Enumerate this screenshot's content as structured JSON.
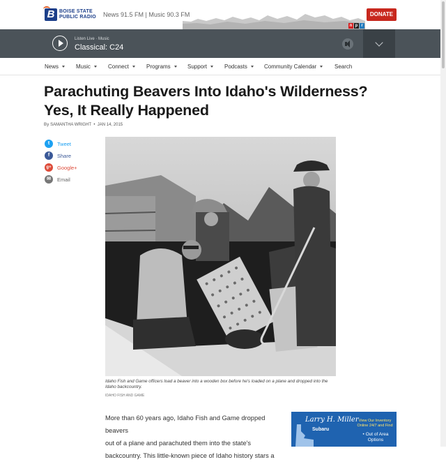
{
  "header": {
    "logo": {
      "line1": "BOISE STATE",
      "line2": "PUBLIC RADIO"
    },
    "stations": "News 91.5 FM | Music 90.3 FM",
    "donate_label": "DONATE",
    "npr_letters": [
      "n",
      "p",
      "r"
    ]
  },
  "player": {
    "listen_label": "Listen Live · Music",
    "now_playing": "Classical: C24"
  },
  "nav": {
    "items": [
      {
        "label": "News"
      },
      {
        "label": "Music"
      },
      {
        "label": "Connect"
      },
      {
        "label": "Programs"
      },
      {
        "label": "Support"
      },
      {
        "label": "Podcasts"
      },
      {
        "label": "Community Calendar"
      },
      {
        "label": "Search"
      }
    ]
  },
  "article": {
    "title_line1": "Parachuting Beavers Into Idaho's Wilderness?",
    "title_line2": "Yes, It Really Happened",
    "byline_by": "By",
    "author": "SAMANTHA WRIGHT",
    "separator": "•",
    "date": "JAN 14, 2015",
    "caption": "Idaho Fish and Game officers load a beaver into a wooden box before he's loaded on a plane and dropped into the Idaho backcountry.",
    "credit": "IDAHO FISH AND GAME",
    "body_lines": [
      "More than 60 years ago, Idaho Fish and Game dropped beavers",
      "out of a plane and parachuted them into the state's",
      "backcountry. This little-known piece of Idaho history stars a"
    ]
  },
  "share": {
    "items": [
      {
        "label": "Tweet",
        "glyph": "t",
        "color": "#1da1f2"
      },
      {
        "label": "Share",
        "glyph": "f",
        "color": "#3b5998"
      },
      {
        "label": "Google+",
        "glyph": "g+",
        "color": "#dd4b39"
      },
      {
        "label": "Email",
        "glyph": "✉",
        "color": "#777777"
      }
    ]
  },
  "ad": {
    "signature": "Larry H. Miller",
    "brand": "Subaru",
    "line_a": "View Our Inventory Online 24/7 and Find",
    "line_b": "• Out of Area Options"
  },
  "colors": {
    "brand_blue": "#1c3f8a",
    "donate_red": "#c8281e",
    "player_bg": "#4b5359"
  }
}
